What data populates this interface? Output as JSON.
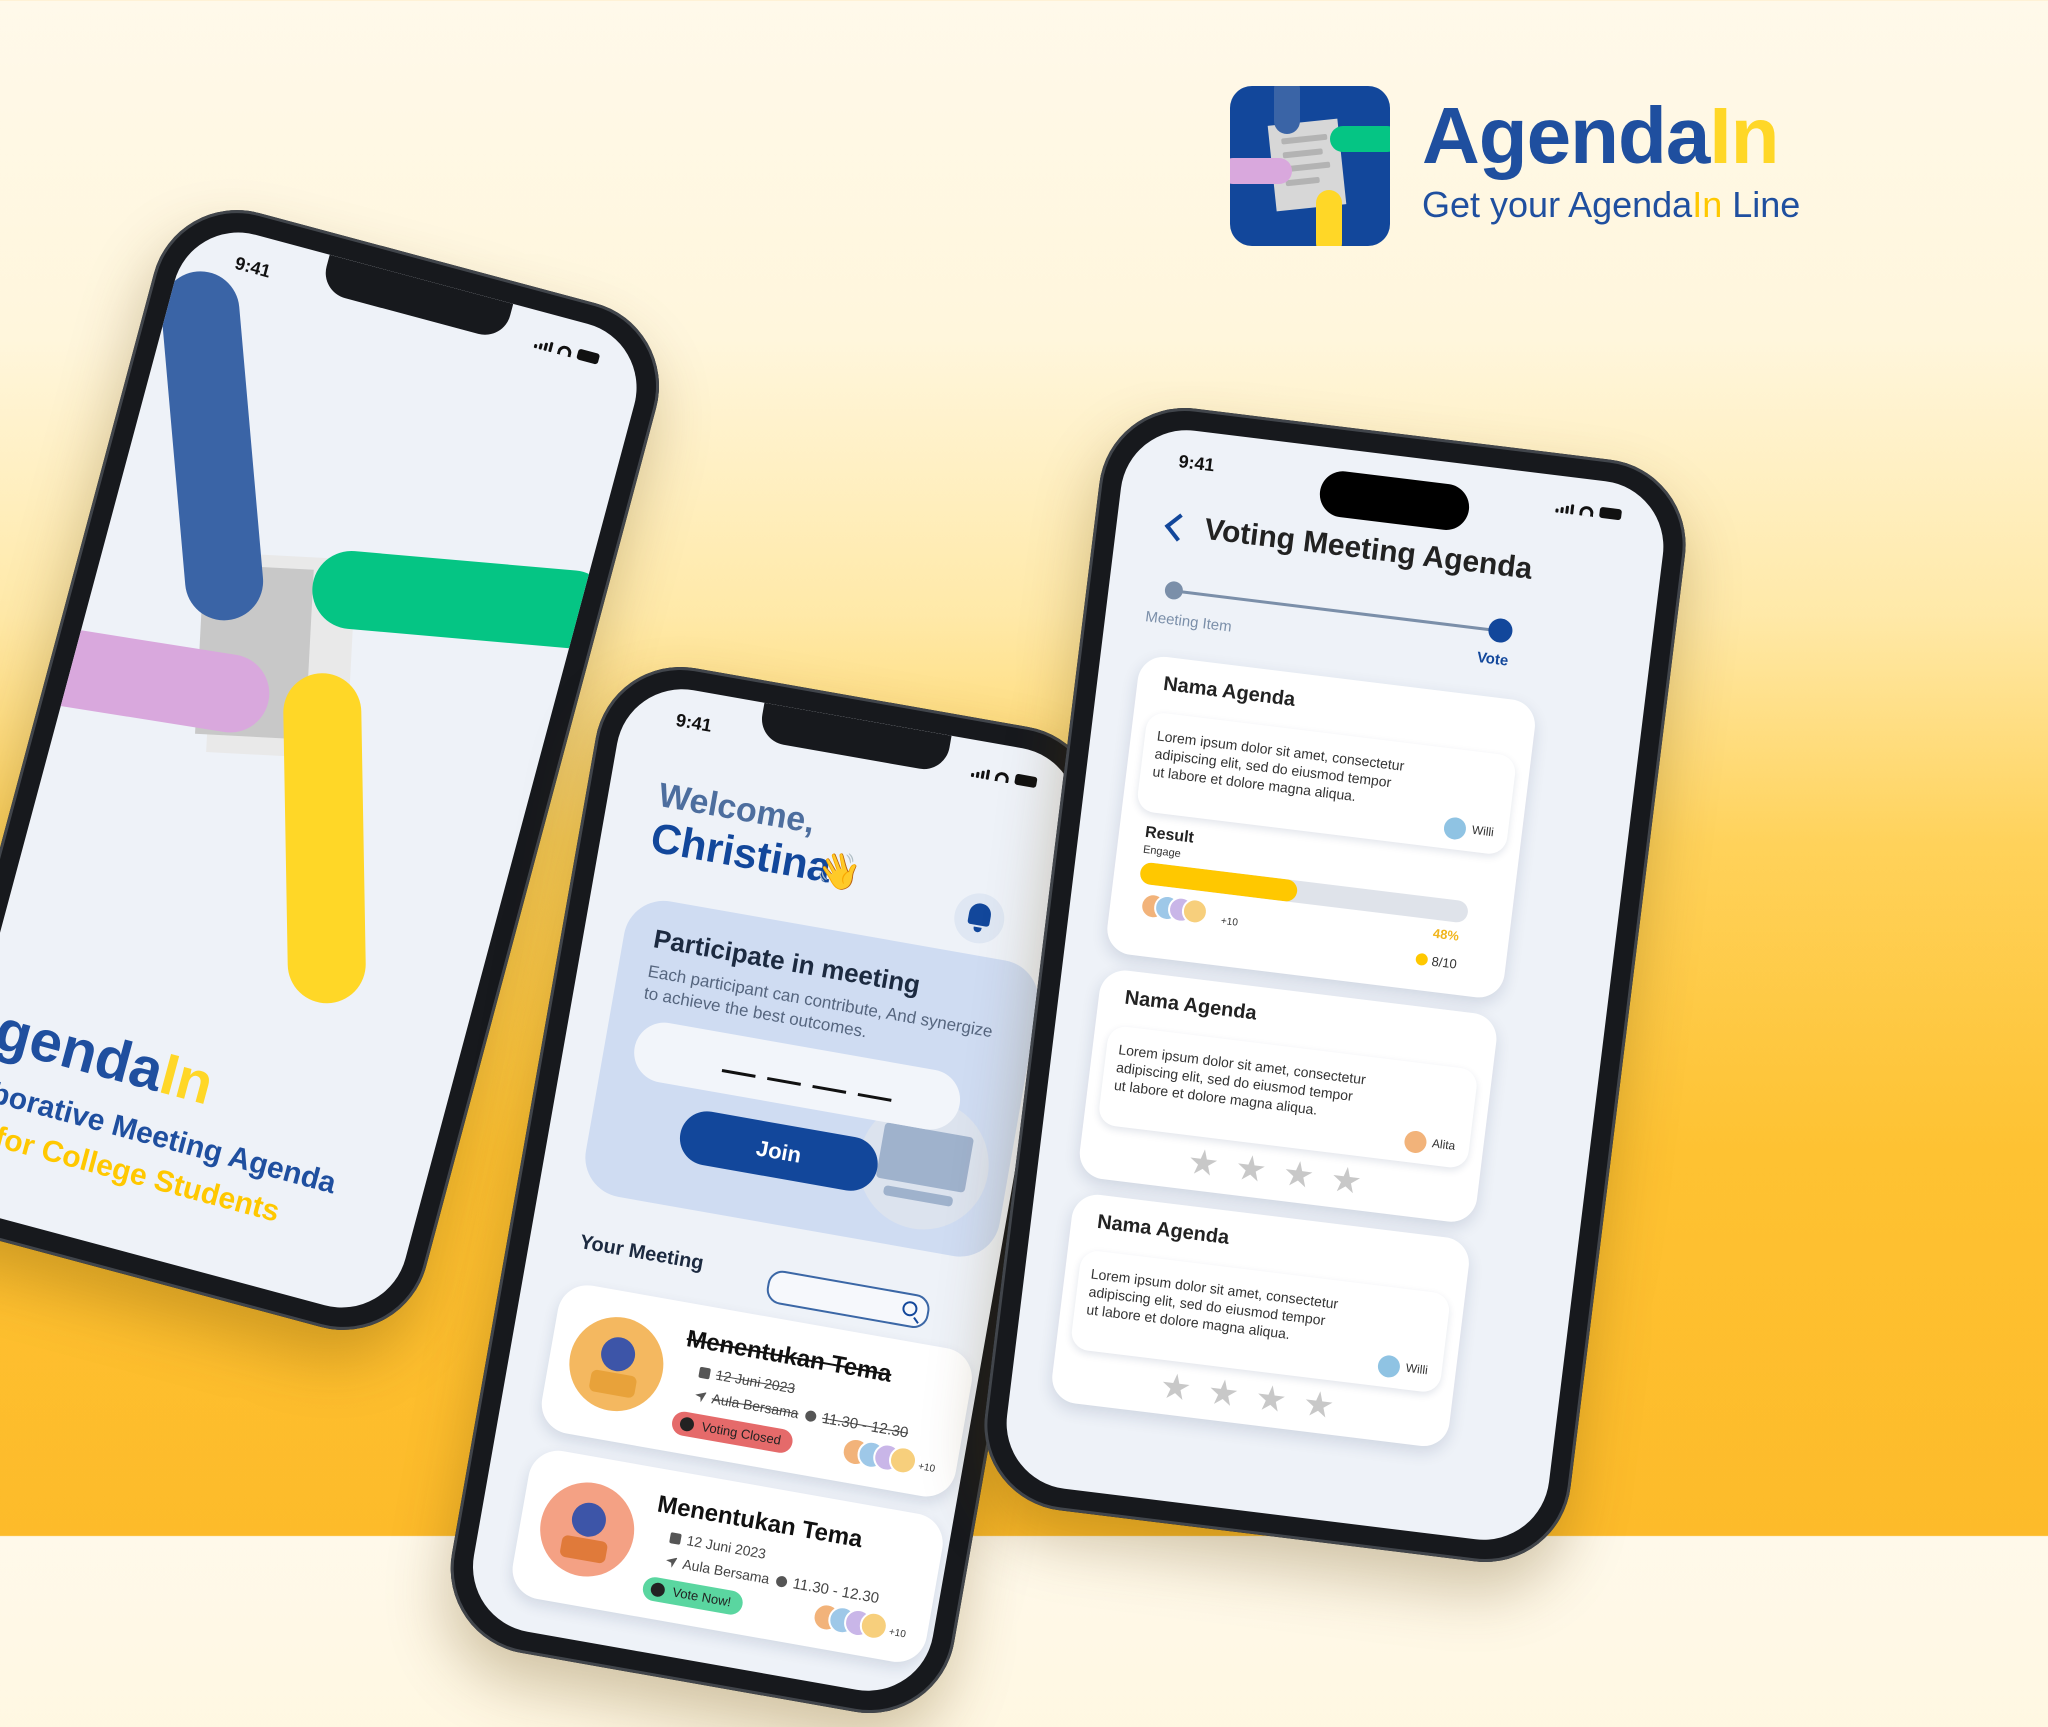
{
  "brand": {
    "name_main": "Agenda",
    "name_accent": "In",
    "tagline_pre": "Get your Agenda",
    "tagline_accent": "In",
    "tagline_post": " Line"
  },
  "colors": {
    "brand_blue": "#12479b",
    "accent_yellow": "#ffd727",
    "green": "#05c584",
    "lilac": "#d9a8dd",
    "status_red": "#e56a6a",
    "status_green": "#5ad6a0"
  },
  "phone1": {
    "status_time": "9:41",
    "title_main": "Agenda",
    "title_accent": "In",
    "subtitle1": "Collaborative Meeting Agenda",
    "subtitle2": "Polling for College Students"
  },
  "phone2": {
    "status_time": "9:41",
    "welcome": "Welcome,",
    "name": "Christina",
    "wave_emoji": "👋",
    "join_title": "Participate in meeting",
    "join_desc": "Each participant can contribute, And synergize to achieve the best outcomes.",
    "join_button": "Join",
    "section_title": "Your Meeting",
    "meetings": [
      {
        "title": "Menentukan Tema",
        "date": "12 Juni 2023",
        "place": "Aula Bersama",
        "time": "11.30 - 12.30",
        "status": "Voting Closed",
        "more": "+10"
      },
      {
        "title": "Menentukan Tema",
        "date": "12 Juni 2023",
        "place": "Aula Bersama",
        "time": "11.30 - 12.30",
        "status": "Vote Now!",
        "more": "+10"
      }
    ]
  },
  "phone3": {
    "status_time": "9:41",
    "title": "Voting Meeting Agenda",
    "step_from": "Meeting Item",
    "step_to": "Vote",
    "agendas": [
      {
        "title": "Nama Agenda",
        "desc": "Lorem ipsum dolor sit amet, consectetur adipiscing elit, sed do eiusmod tempor ut labore et dolore magna aliqua.",
        "user": "Willi",
        "result_label": "Result",
        "engage_label": "Engage",
        "percent": "48%",
        "progress_value": 0.48,
        "votes": "8/10",
        "more": "+10"
      },
      {
        "title": "Nama Agenda",
        "desc": "Lorem ipsum dolor sit amet, consectetur adipiscing elit, sed do eiusmod tempor ut labore et dolore magna aliqua.",
        "user": "Alita",
        "rating": 0
      },
      {
        "title": "Nama Agenda",
        "desc": "Lorem ipsum dolor sit amet, consectetur adipiscing elit, sed do eiusmod tempor ut labore et dolore magna aliqua.",
        "user": "Willi",
        "rating": 0
      }
    ]
  }
}
